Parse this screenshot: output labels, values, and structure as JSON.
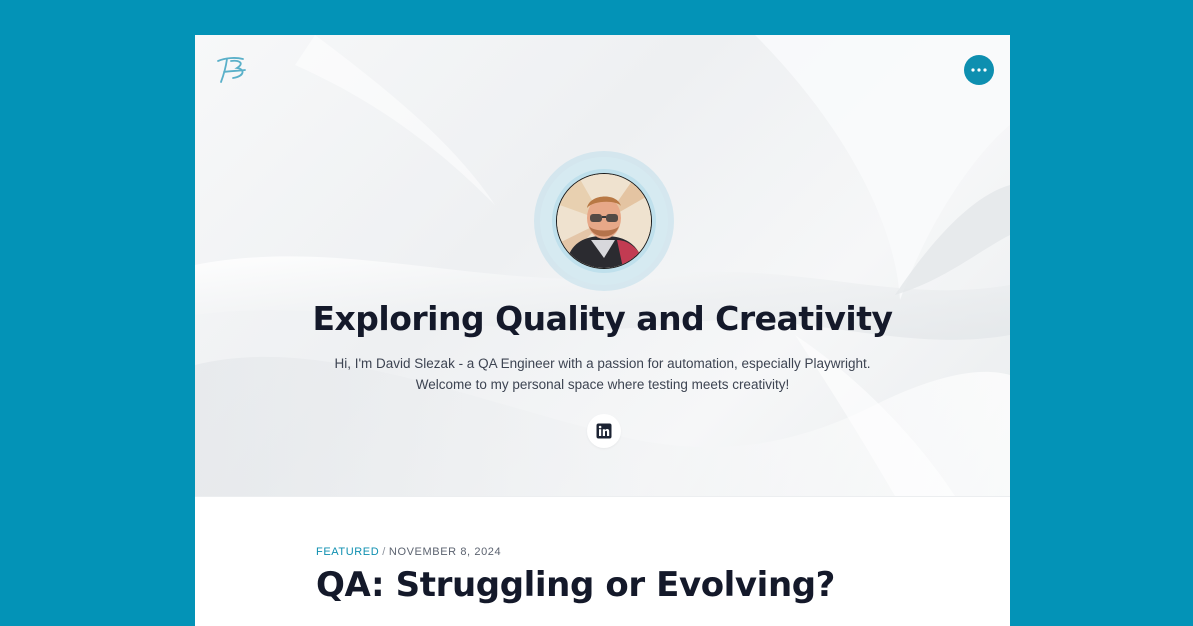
{
  "site": {
    "background_color": "#0393b7",
    "accent_color": "#0e8fb0",
    "logo_icon": "signature-logo-icon",
    "menu_icon": "more-dots-icon"
  },
  "hero": {
    "title": "Exploring Quality and Creativity",
    "description_line1": "Hi, I'm David Slezak - a QA Engineer with a passion for automation, especially Playwright.",
    "description_line2": "Welcome to my personal space where testing meets creativity!",
    "avatar_alt": "David Slezak",
    "social_icon": "linkedin-icon"
  },
  "post": {
    "tag": "Featured",
    "separator": "/",
    "date": "November 8, 2024",
    "title": "QA: Struggling or Evolving?"
  }
}
